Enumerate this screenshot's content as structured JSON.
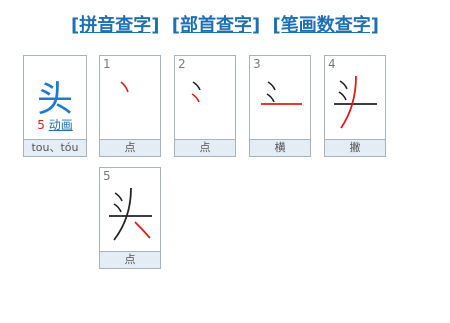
{
  "nav_links": [
    "[拼音查字]",
    "[部首查字]",
    "[笔画数查字]"
  ],
  "character": {
    "glyph": "头",
    "stroke_count": "5",
    "animation_label": "动画",
    "pinyin": "tou、tóu"
  },
  "strokes": [
    {
      "number": "1",
      "name": "点"
    },
    {
      "number": "2",
      "name": "点"
    },
    {
      "number": "3",
      "name": "横"
    },
    {
      "number": "4",
      "name": "撇"
    },
    {
      "number": "5",
      "name": "点"
    }
  ],
  "colors": {
    "link": "#1f6fb5",
    "glyph": "#1a7bd1",
    "current_stroke": "#e01b1b",
    "count": "#e01b1b"
  }
}
